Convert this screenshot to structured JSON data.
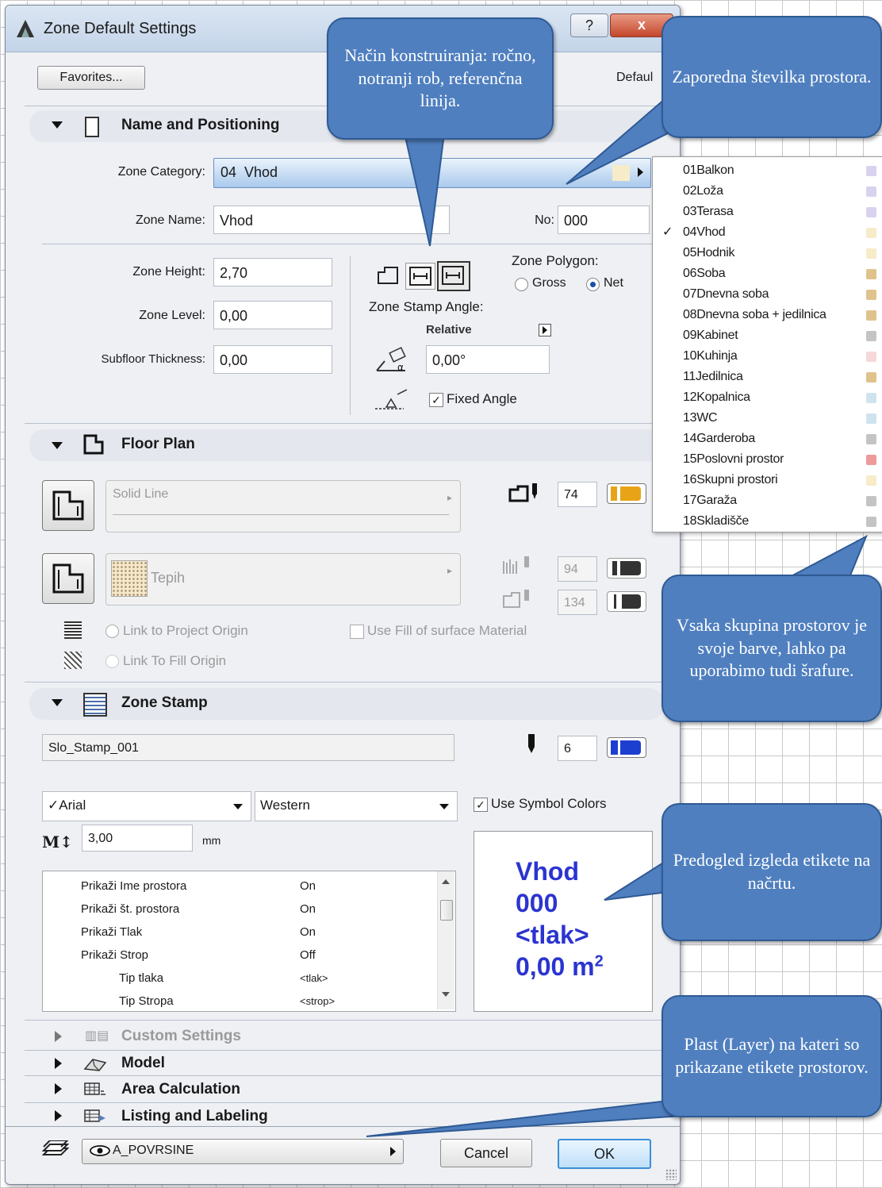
{
  "window": {
    "title": "Zone Default Settings",
    "help_glyph": "?",
    "close_glyph": "x"
  },
  "toolbar": {
    "favorites_label": "Favorites...",
    "default_label": "Defaul"
  },
  "name_positioning": {
    "header": "Name and Positioning",
    "zone_category_label": "Zone Category:",
    "zone_category_value": "04  Vhod",
    "zone_name_label": "Zone Name:",
    "zone_name_value": "Vhod",
    "no_label": "No:",
    "no_value": "000",
    "zone_height_label": "Zone Height:",
    "zone_height_value": "2,70",
    "zone_level_label": "Zone Level:",
    "zone_level_value": "0,00",
    "subfloor_label": "Subfloor Thickness:",
    "subfloor_value": "0,00",
    "polygon_label": "Zone Polygon:",
    "gross_label": "Gross",
    "net_label": "Net",
    "stamp_angle_label": "Zone Stamp Angle:",
    "relative_label": "Relative",
    "angle_value": "0,00°",
    "fixed_angle_label": "Fixed Angle"
  },
  "floor_plan": {
    "header": "Floor Plan",
    "line_type": "Solid Line",
    "pen_1": "74",
    "fill_name": "Tepih",
    "pen_2": "94",
    "pen_3": "134",
    "link_project_origin": "Link to Project Origin",
    "link_fill_origin": "Link To Fill Origin",
    "use_fill_material": "Use Fill of surface Material"
  },
  "zone_stamp": {
    "header": "Zone Stamp",
    "stamp_name": "Slo_Stamp_001",
    "pen": "6",
    "font": "✓Arial",
    "script": "Western",
    "use_symbol_colors": "Use Symbol Colors",
    "size_value": "3,00",
    "size_unit": "mm",
    "params": [
      {
        "name": "Prikaži Ime prostora",
        "value": "On",
        "indent": false
      },
      {
        "name": "Prikaži št. prostora",
        "value": "On",
        "indent": false
      },
      {
        "name": "Prikaži Tlak",
        "value": "On",
        "indent": false
      },
      {
        "name": "Prikaži Strop",
        "value": "Off",
        "indent": false
      },
      {
        "name": "Tip tlaka",
        "value": "<tlak>",
        "indent": true
      },
      {
        "name": "Tip Stropa",
        "value": "<strop>",
        "indent": true
      }
    ],
    "preview": {
      "line1": "Vhod",
      "line2": "000",
      "line3": "<tlak>",
      "line4": "0,00 m",
      "line4_sup": "2"
    }
  },
  "collapsed_sections": {
    "custom_settings": "Custom Settings",
    "model": "Model",
    "area_calculation": "Area Calculation",
    "listing_labeling": "Listing and Labeling"
  },
  "footer": {
    "layer": "A_POVRSINE",
    "cancel_label": "Cancel",
    "ok_label": "OK"
  },
  "category_list": [
    {
      "num": "01",
      "name": "Balkon",
      "color": "#d9d2ef",
      "checked": ""
    },
    {
      "num": "02",
      "name": "Loža",
      "color": "#d9d2ef",
      "checked": ""
    },
    {
      "num": "03",
      "name": "Terasa",
      "color": "#d9d2ef",
      "checked": ""
    },
    {
      "num": "04",
      "name": "Vhod",
      "color": "#f7ecc9",
      "checked": "✓"
    },
    {
      "num": "05",
      "name": "Hodnik",
      "color": "#f7ecc9",
      "checked": ""
    },
    {
      "num": "06",
      "name": "Soba",
      "color": "#e0c38c",
      "checked": ""
    },
    {
      "num": "07",
      "name": "Dnevna soba",
      "color": "#e0c38c",
      "checked": ""
    },
    {
      "num": "08",
      "name": "Dnevna soba + jedilnica",
      "color": "#e0c38c",
      "checked": ""
    },
    {
      "num": "09",
      "name": "Kabinet",
      "color": "#c4c4c4",
      "checked": ""
    },
    {
      "num": "10",
      "name": "Kuhinja",
      "color": "#f6d8d8",
      "checked": ""
    },
    {
      "num": "11",
      "name": "Jedilnica",
      "color": "#e0c38c",
      "checked": ""
    },
    {
      "num": "12",
      "name": "Kopalnica",
      "color": "#cfe3ee",
      "checked": ""
    },
    {
      "num": "13",
      "name": "WC",
      "color": "#cfe3ee",
      "checked": ""
    },
    {
      "num": "14",
      "name": "Garderoba",
      "color": "#c4c4c4",
      "checked": ""
    },
    {
      "num": "15",
      "name": "Poslovni prostor",
      "color": "#ee9a9a",
      "checked": ""
    },
    {
      "num": "16",
      "name": "Skupni prostori",
      "color": "#f7ecc9",
      "checked": ""
    },
    {
      "num": "17",
      "name": "Garaža",
      "color": "#c4c4c4",
      "checked": ""
    },
    {
      "num": "18",
      "name": "Skladišče",
      "color": "#c4c4c4",
      "checked": ""
    }
  ],
  "callouts": {
    "construction": "Način konstruiranja: ročno, notranji rob, referenčna linija.",
    "number": "Zaporedna številka prostora.",
    "colors": "Vsaka skupina prostorov je svoje barve, lahko pa uporabimo tudi šrafure.",
    "preview": "Predogled izgleda etikete na načrtu.",
    "layer": "Plast (Layer) na kateri so prikazane etikete prostorov."
  },
  "colors": {
    "accent_blue": "#4f7fbf",
    "pen_orange": "#e8a317",
    "pen_blue": "#1d3fd0",
    "preview_text": "#2b34d0"
  }
}
